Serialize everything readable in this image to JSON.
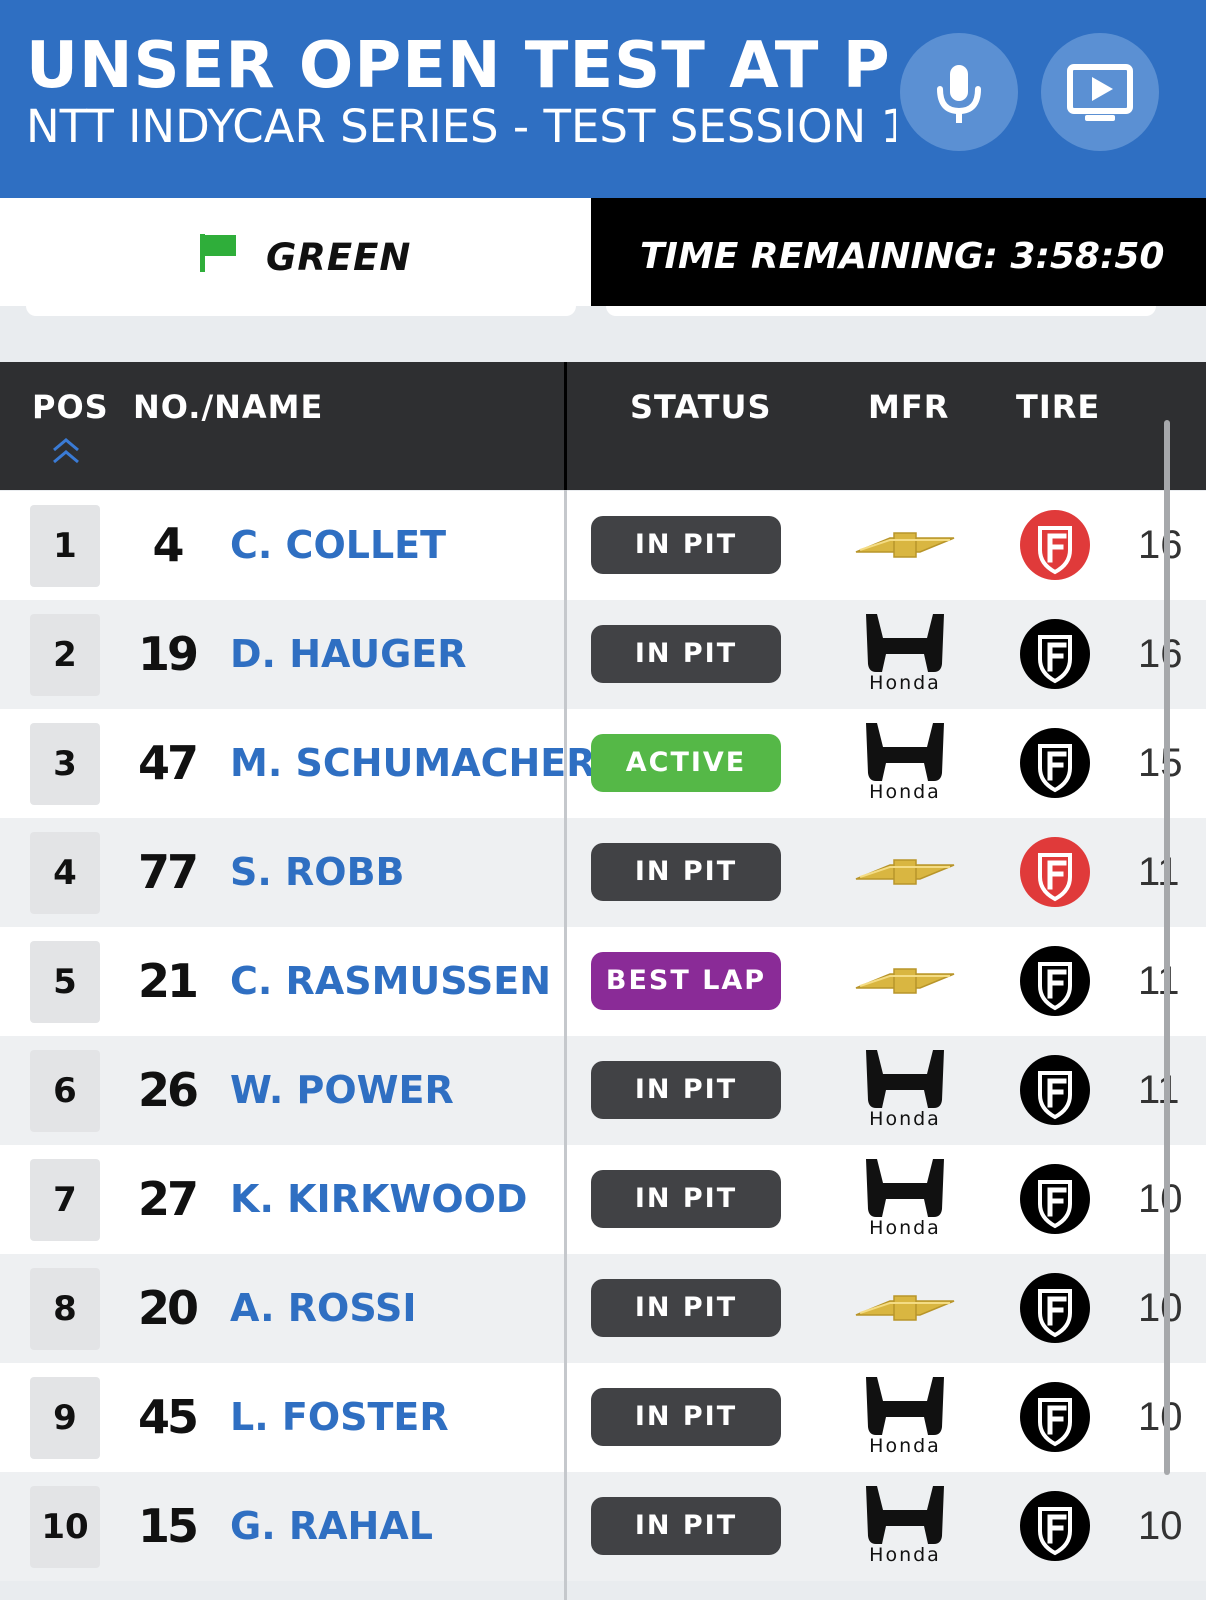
{
  "header": {
    "title": "UNSER OPEN TEST AT PHO",
    "subtitle": "NTT INDYCAR SERIES - TEST SESSION 1",
    "mic_icon": "microphone-icon",
    "tv_icon": "video-play-icon"
  },
  "status_bar": {
    "flag_label": "GREEN",
    "flag_color": "#2fae3a",
    "time_remaining": "TIME REMAINING: 3:58:50"
  },
  "columns": {
    "pos": "POS",
    "name": "NO./NAME",
    "status": "STATUS",
    "mfr": "MFR",
    "tire": "TIRE"
  },
  "colors": {
    "brand_blue": "#2f6fc2",
    "in_pit": "#414245",
    "active": "#55b847",
    "best_lap": "#8a2b97",
    "tire_red": "#e03a3a",
    "tire_black": "#000000"
  },
  "rows": [
    {
      "pos": "1",
      "number": "4",
      "driver": "C. COLLET",
      "status": "IN PIT",
      "status_type": "in_pit",
      "mfr": "chevrolet",
      "mfr_label": "",
      "tire": "red",
      "laps": "16"
    },
    {
      "pos": "2",
      "number": "19",
      "driver": "D. HAUGER",
      "status": "IN PIT",
      "status_type": "in_pit",
      "mfr": "honda",
      "mfr_label": "Honda",
      "tire": "black",
      "laps": "16"
    },
    {
      "pos": "3",
      "number": "47",
      "driver": "M. SCHUMACHER",
      "status": "ACTIVE",
      "status_type": "active",
      "mfr": "honda",
      "mfr_label": "Honda",
      "tire": "black",
      "laps": "15"
    },
    {
      "pos": "4",
      "number": "77",
      "driver": "S. ROBB",
      "status": "IN PIT",
      "status_type": "in_pit",
      "mfr": "chevrolet",
      "mfr_label": "",
      "tire": "red",
      "laps": "11"
    },
    {
      "pos": "5",
      "number": "21",
      "driver": "C. RASMUSSEN",
      "status": "BEST LAP",
      "status_type": "best_lap",
      "mfr": "chevrolet",
      "mfr_label": "",
      "tire": "black",
      "laps": "11"
    },
    {
      "pos": "6",
      "number": "26",
      "driver": "W. POWER",
      "status": "IN PIT",
      "status_type": "in_pit",
      "mfr": "honda",
      "mfr_label": "Honda",
      "tire": "black",
      "laps": "11"
    },
    {
      "pos": "7",
      "number": "27",
      "driver": "K. KIRKWOOD",
      "status": "IN PIT",
      "status_type": "in_pit",
      "mfr": "honda",
      "mfr_label": "Honda",
      "tire": "black",
      "laps": "10"
    },
    {
      "pos": "8",
      "number": "20",
      "driver": "A. ROSSI",
      "status": "IN PIT",
      "status_type": "in_pit",
      "mfr": "chevrolet",
      "mfr_label": "",
      "tire": "black",
      "laps": "10"
    },
    {
      "pos": "9",
      "number": "45",
      "driver": "L. FOSTER",
      "status": "IN PIT",
      "status_type": "in_pit",
      "mfr": "honda",
      "mfr_label": "Honda",
      "tire": "black",
      "laps": "10"
    },
    {
      "pos": "10",
      "number": "15",
      "driver": "G. RAHAL",
      "status": "IN PIT",
      "status_type": "in_pit",
      "mfr": "honda",
      "mfr_label": "Honda",
      "tire": "black",
      "laps": "10"
    }
  ]
}
